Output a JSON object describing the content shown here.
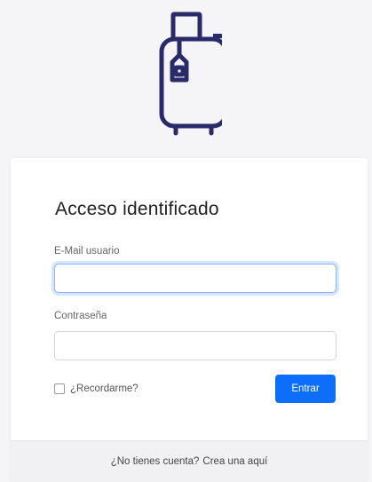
{
  "logo": {
    "icon": "suitcase-icon",
    "color": "#2a2a6a"
  },
  "login": {
    "title": "Acceso identificado",
    "email_label": "E-Mail usuario",
    "email_value": "",
    "password_label": "Contraseña",
    "password_value": "",
    "remember_label": "¿Recordarme?",
    "remember_checked": false,
    "submit_label": "Entrar",
    "accent_color": "#0d6efd"
  },
  "footer": {
    "text": "¿No tienes cuenta?",
    "link_text": "Crea una aquí"
  }
}
